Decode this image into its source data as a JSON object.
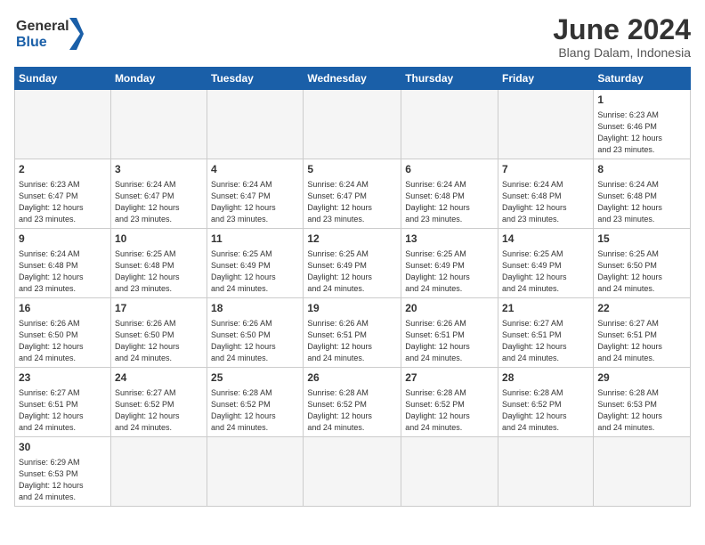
{
  "logo": {
    "line1": "General",
    "line2": "Blue"
  },
  "title": "June 2024",
  "subtitle": "Blang Dalam, Indonesia",
  "days_of_week": [
    "Sunday",
    "Monday",
    "Tuesday",
    "Wednesday",
    "Thursday",
    "Friday",
    "Saturday"
  ],
  "weeks": [
    [
      {
        "day": "",
        "info": ""
      },
      {
        "day": "",
        "info": ""
      },
      {
        "day": "",
        "info": ""
      },
      {
        "day": "",
        "info": ""
      },
      {
        "day": "",
        "info": ""
      },
      {
        "day": "",
        "info": ""
      },
      {
        "day": "1",
        "info": "Sunrise: 6:23 AM\nSunset: 6:46 PM\nDaylight: 12 hours\nand 23 minutes."
      }
    ],
    [
      {
        "day": "2",
        "info": "Sunrise: 6:23 AM\nSunset: 6:47 PM\nDaylight: 12 hours\nand 23 minutes."
      },
      {
        "day": "3",
        "info": "Sunrise: 6:24 AM\nSunset: 6:47 PM\nDaylight: 12 hours\nand 23 minutes."
      },
      {
        "day": "4",
        "info": "Sunrise: 6:24 AM\nSunset: 6:47 PM\nDaylight: 12 hours\nand 23 minutes."
      },
      {
        "day": "5",
        "info": "Sunrise: 6:24 AM\nSunset: 6:47 PM\nDaylight: 12 hours\nand 23 minutes."
      },
      {
        "day": "6",
        "info": "Sunrise: 6:24 AM\nSunset: 6:48 PM\nDaylight: 12 hours\nand 23 minutes."
      },
      {
        "day": "7",
        "info": "Sunrise: 6:24 AM\nSunset: 6:48 PM\nDaylight: 12 hours\nand 23 minutes."
      },
      {
        "day": "8",
        "info": "Sunrise: 6:24 AM\nSunset: 6:48 PM\nDaylight: 12 hours\nand 23 minutes."
      }
    ],
    [
      {
        "day": "9",
        "info": "Sunrise: 6:24 AM\nSunset: 6:48 PM\nDaylight: 12 hours\nand 23 minutes."
      },
      {
        "day": "10",
        "info": "Sunrise: 6:25 AM\nSunset: 6:48 PM\nDaylight: 12 hours\nand 23 minutes."
      },
      {
        "day": "11",
        "info": "Sunrise: 6:25 AM\nSunset: 6:49 PM\nDaylight: 12 hours\nand 24 minutes."
      },
      {
        "day": "12",
        "info": "Sunrise: 6:25 AM\nSunset: 6:49 PM\nDaylight: 12 hours\nand 24 minutes."
      },
      {
        "day": "13",
        "info": "Sunrise: 6:25 AM\nSunset: 6:49 PM\nDaylight: 12 hours\nand 24 minutes."
      },
      {
        "day": "14",
        "info": "Sunrise: 6:25 AM\nSunset: 6:49 PM\nDaylight: 12 hours\nand 24 minutes."
      },
      {
        "day": "15",
        "info": "Sunrise: 6:25 AM\nSunset: 6:50 PM\nDaylight: 12 hours\nand 24 minutes."
      }
    ],
    [
      {
        "day": "16",
        "info": "Sunrise: 6:26 AM\nSunset: 6:50 PM\nDaylight: 12 hours\nand 24 minutes."
      },
      {
        "day": "17",
        "info": "Sunrise: 6:26 AM\nSunset: 6:50 PM\nDaylight: 12 hours\nand 24 minutes."
      },
      {
        "day": "18",
        "info": "Sunrise: 6:26 AM\nSunset: 6:50 PM\nDaylight: 12 hours\nand 24 minutes."
      },
      {
        "day": "19",
        "info": "Sunrise: 6:26 AM\nSunset: 6:51 PM\nDaylight: 12 hours\nand 24 minutes."
      },
      {
        "day": "20",
        "info": "Sunrise: 6:26 AM\nSunset: 6:51 PM\nDaylight: 12 hours\nand 24 minutes."
      },
      {
        "day": "21",
        "info": "Sunrise: 6:27 AM\nSunset: 6:51 PM\nDaylight: 12 hours\nand 24 minutes."
      },
      {
        "day": "22",
        "info": "Sunrise: 6:27 AM\nSunset: 6:51 PM\nDaylight: 12 hours\nand 24 minutes."
      }
    ],
    [
      {
        "day": "23",
        "info": "Sunrise: 6:27 AM\nSunset: 6:51 PM\nDaylight: 12 hours\nand 24 minutes."
      },
      {
        "day": "24",
        "info": "Sunrise: 6:27 AM\nSunset: 6:52 PM\nDaylight: 12 hours\nand 24 minutes."
      },
      {
        "day": "25",
        "info": "Sunrise: 6:28 AM\nSunset: 6:52 PM\nDaylight: 12 hours\nand 24 minutes."
      },
      {
        "day": "26",
        "info": "Sunrise: 6:28 AM\nSunset: 6:52 PM\nDaylight: 12 hours\nand 24 minutes."
      },
      {
        "day": "27",
        "info": "Sunrise: 6:28 AM\nSunset: 6:52 PM\nDaylight: 12 hours\nand 24 minutes."
      },
      {
        "day": "28",
        "info": "Sunrise: 6:28 AM\nSunset: 6:52 PM\nDaylight: 12 hours\nand 24 minutes."
      },
      {
        "day": "29",
        "info": "Sunrise: 6:28 AM\nSunset: 6:53 PM\nDaylight: 12 hours\nand 24 minutes."
      }
    ],
    [
      {
        "day": "30",
        "info": "Sunrise: 6:29 AM\nSunset: 6:53 PM\nDaylight: 12 hours\nand 24 minutes."
      },
      {
        "day": "",
        "info": ""
      },
      {
        "day": "",
        "info": ""
      },
      {
        "day": "",
        "info": ""
      },
      {
        "day": "",
        "info": ""
      },
      {
        "day": "",
        "info": ""
      },
      {
        "day": "",
        "info": ""
      }
    ]
  ]
}
